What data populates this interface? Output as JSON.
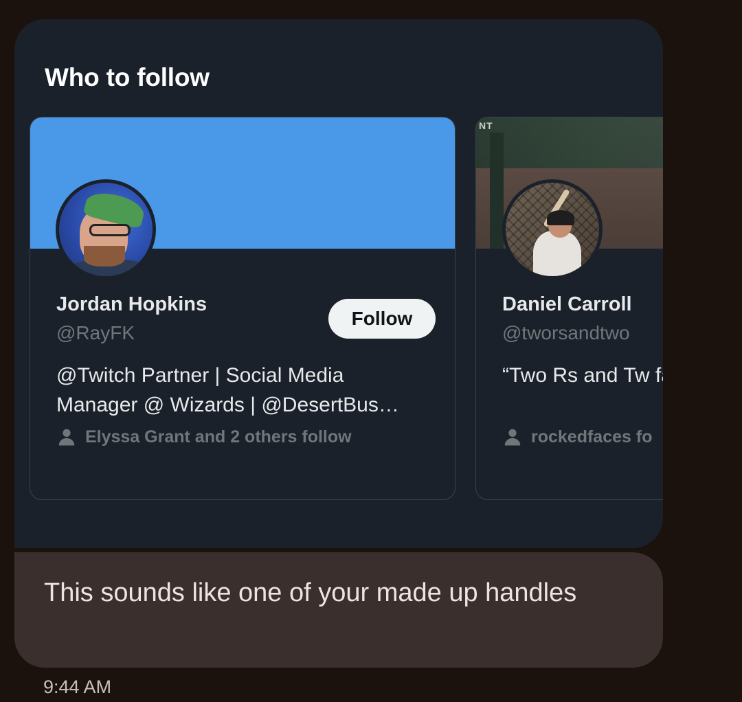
{
  "section": {
    "title": "Who to follow"
  },
  "cards": [
    {
      "name": "Jordan Hopkins",
      "handle": "@RayFK",
      "bio": "@Twitch Partner | Social Media\nManager @ Wizards | @DesertBus…",
      "follow_label": "Follow",
      "social_proof": "Elyssa Grant and 2 others follow",
      "banner_color": "#4a99e9"
    },
    {
      "name": "Daniel Carroll",
      "handle": "@tworsandtwo",
      "bio": "“Two Rs and Tw\nfavourite troll | S",
      "social_proof": "rockedfaces fo",
      "banner_sign": "NT"
    }
  ],
  "message": {
    "text": "This sounds like one of your made up handles",
    "time": "9:44 AM"
  },
  "colors": {
    "page_background": "#1b120d",
    "card_background": "#1a212a",
    "reply_bubble": "#3a2f2c",
    "muted_text": "#71767b",
    "follow_button": "#eff3f4"
  },
  "icons": {
    "social_proof": "person-icon"
  }
}
